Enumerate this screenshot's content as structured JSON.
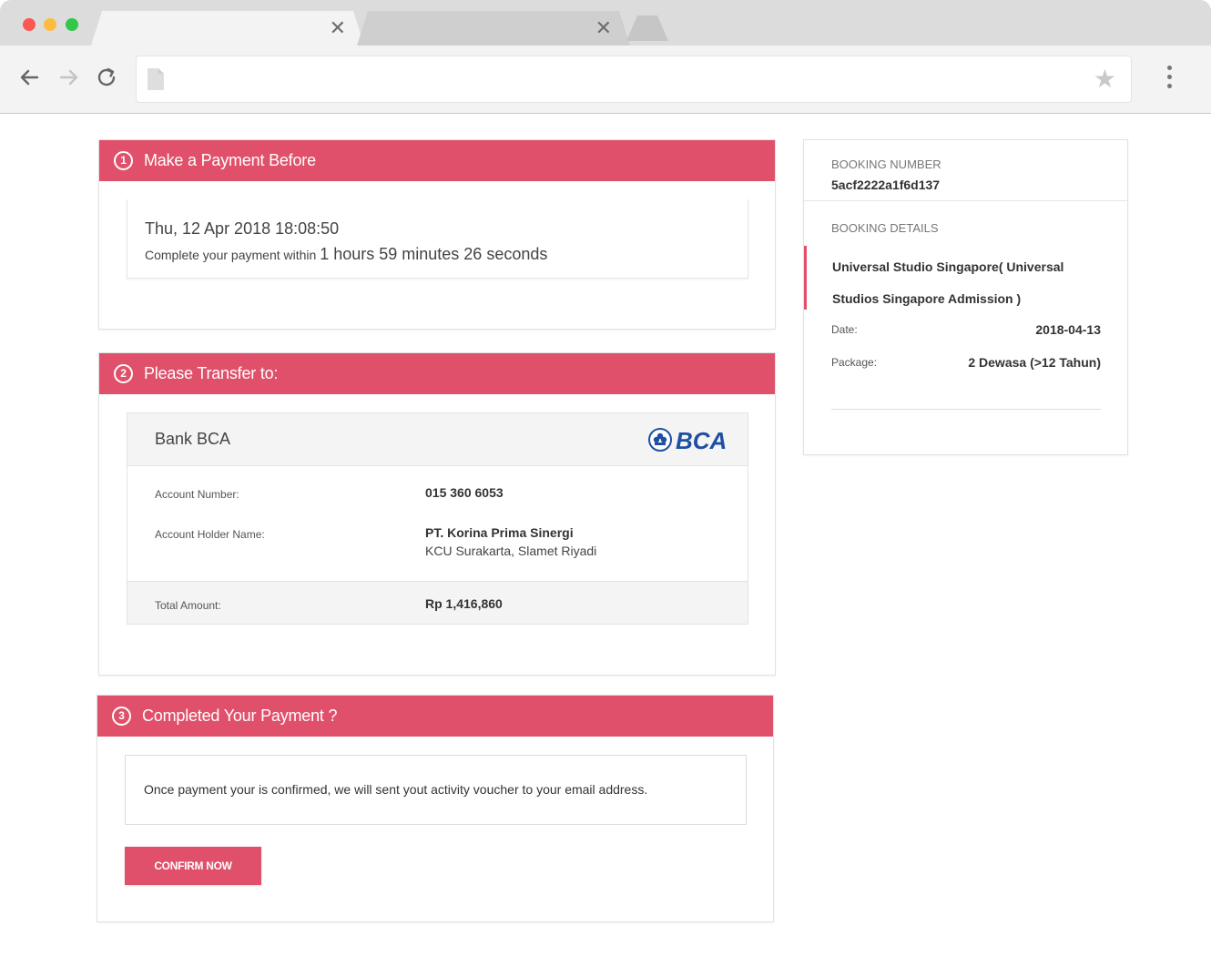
{
  "browser": {
    "tabs": [
      {
        "label": "",
        "close": "✕"
      },
      {
        "label": "",
        "close": "✕"
      }
    ]
  },
  "step1": {
    "number": "1",
    "title": "Make a Payment Before",
    "deadline": "Thu, 12 Apr 2018 18:08:50",
    "remaining_prefix": "Complete your payment within",
    "remaining_time": "1 hours 59 minutes 26 seconds"
  },
  "step2": {
    "number": "2",
    "title": "Please Transfer to:",
    "bank_name": "Bank BCA",
    "logo_text": "BCA",
    "account_number_label": "Account Number:",
    "account_number": "015 360 6053",
    "holder_label": "Account Holder Name:",
    "holder_name": "PT. Korina Prima Sinergi",
    "holder_branch": "KCU Surakarta, Slamet Riyadi",
    "total_label": "Total Amount:",
    "total_value": "Rp 1,416,860"
  },
  "step3": {
    "number": "3",
    "title": "Completed Your Payment ?",
    "message": "Once payment your is confirmed, we will sent yout activity voucher to your email address.",
    "confirm_label": "CONFIRM NOW"
  },
  "sidebar": {
    "booking_number_label": "BOOKING NUMBER",
    "booking_number": "5acf2222a1f6d137",
    "booking_details_label": "BOOKING DETAILS",
    "product_line1": "Universal Studio Singapore( Universal",
    "product_line2": "Studios Singapore Admission )",
    "date_label": "Date:",
    "date_value": "2018-04-13",
    "package_label": "Package:",
    "package_value": "2 Dewasa (>12 Tahun)"
  },
  "colors": {
    "accent": "#e0506a",
    "logo_blue": "#1f4fa3"
  }
}
